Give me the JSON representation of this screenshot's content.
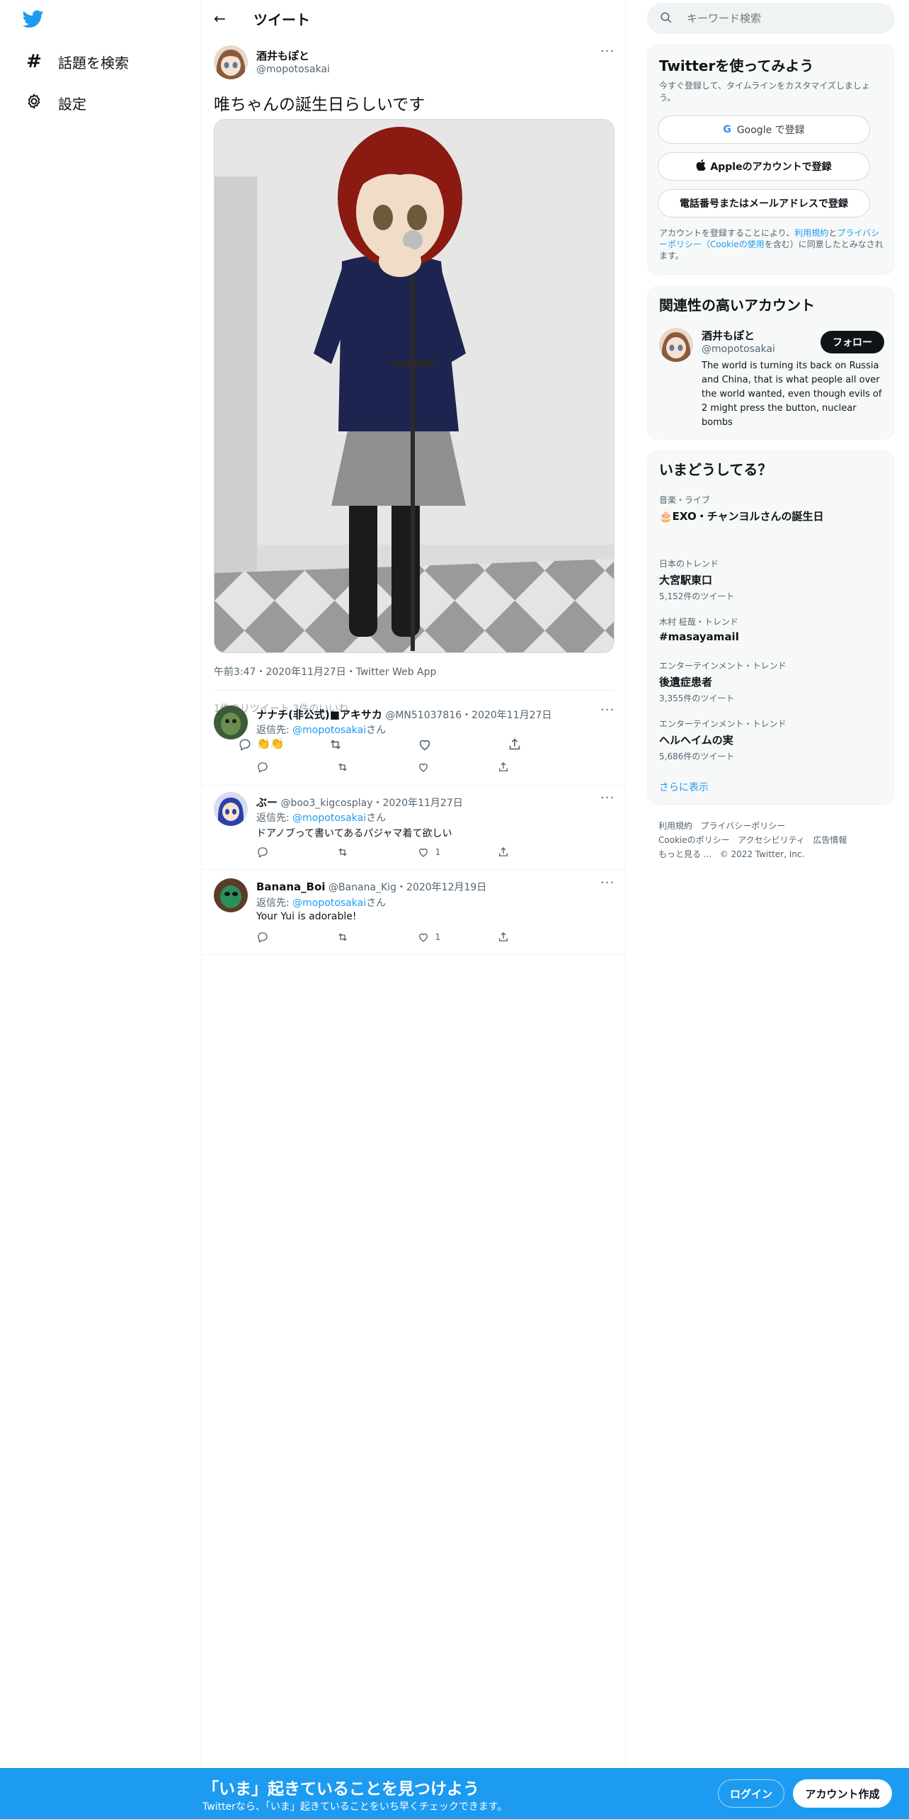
{
  "nav": {
    "items": [
      {
        "label": "話題を検索",
        "icon": "hashtag-icon"
      },
      {
        "label": "設定",
        "icon": "gear-icon"
      }
    ]
  },
  "header": {
    "title": "ツイート"
  },
  "tweet": {
    "name": "酒井もぽと",
    "handle": "@mopotosakai",
    "text": "唯ちゃんの誕生日らしいです",
    "timestamp": "午前3:47・2020年11月27日・Twitter Web App",
    "stats_overlap": "1件のリツイート 3件のいいね"
  },
  "replies": [
    {
      "name": "ナナチ(非公式)■アキサカ",
      "handle": "@MN51037816",
      "date": "・2020年11月27日",
      "replyto_prefix": "返信先: ",
      "replyto_handle": "@mopotosakai",
      "replyto_suffix": "さん",
      "text": "👏👏",
      "likes": ""
    },
    {
      "name": "ぶー",
      "handle": "@boo3_kigcosplay",
      "date": "・2020年11月27日",
      "replyto_prefix": "返信先: ",
      "replyto_handle": "@mopotosakai",
      "replyto_suffix": "さん",
      "text": "ドアノブって書いてあるパジャマ着て欲しい",
      "likes": "1"
    },
    {
      "name": "Banana_Boi",
      "handle": "@Banana_Kig",
      "date": "・2020年12月19日",
      "replyto_prefix": "返信先: ",
      "replyto_handle": "@mopotosakai",
      "replyto_suffix": "さん",
      "text": "Your Yui is adorable!",
      "likes": "1"
    }
  ],
  "search": {
    "placeholder": "キーワード検索"
  },
  "signup": {
    "title": "Twitterを使ってみよう",
    "subtitle": "今すぐ登録して、タイムラインをカスタマイズしましょう。",
    "google": "Google で登録",
    "apple": "Appleのアカウントで登録",
    "phone": "電話番号またはメールアドレスで登録",
    "terms_1": "アカウントを登録することにより、",
    "terms_link1": "利用規約",
    "terms_2": "と",
    "terms_link2": "プライバシーポリシー（Cookieの使用",
    "terms_3": "を含む）に同意したとみなされます。"
  },
  "relevant": {
    "title": "関連性の高いアカウント",
    "name": "酒井もぽと",
    "handle": "@mopotosakai",
    "follow": "フォロー",
    "bio": "The world is turning its back on Russia and China, that is what people all over the world wanted, even though evils of 2 might press the button, nuclear bombs"
  },
  "trends": {
    "title": "いまどうしてる？",
    "items": [
      {
        "cat": "音楽・ライブ",
        "name": "🎂EXO・チャンヨルさんの誕生日",
        "count": ""
      },
      {
        "cat": "日本のトレンド",
        "name": "大宮駅東口",
        "count": "5,152件のツイート"
      },
      {
        "cat": "木村 柾哉・トレンド",
        "name": "#masayamail",
        "count": ""
      },
      {
        "cat": "エンターテインメント・トレンド",
        "name": "後遺症患者",
        "count": "3,355件のツイート"
      },
      {
        "cat": "エンターテインメント・トレンド",
        "name": "ヘルヘイムの実",
        "count": "5,686件のツイート"
      }
    ],
    "more": "さらに表示"
  },
  "footer": {
    "terms": "利用規約",
    "privacy": "プライバシーポリシー",
    "cookie": "Cookieのポリシー",
    "a11y": "アクセシビリティ",
    "ads": "広告情報",
    "more": "もっと見る ...",
    "copyright": "© 2022 Twitter, Inc."
  },
  "bottom": {
    "headline": "「いま」起きていることを見つけよう",
    "sub": "Twitterなら、「いま」起きていることをいち早くチェックできます。",
    "login": "ログイン",
    "signup": "アカウント作成"
  },
  "colors": {
    "accent": "#1d9bf0",
    "text": "#0f1419",
    "muted": "#536471"
  }
}
